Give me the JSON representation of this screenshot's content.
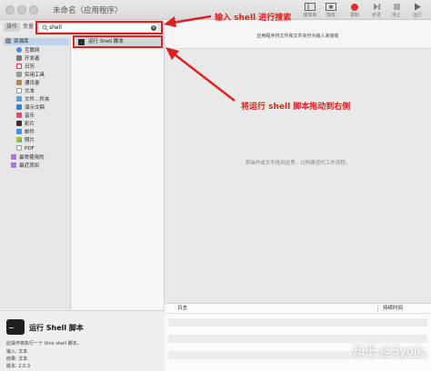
{
  "window": {
    "title": "未命名（应用程序）"
  },
  "toolbar": {
    "buttons": [
      {
        "label": "媒体库",
        "icon": "library-icon"
      },
      {
        "label": "媒体",
        "icon": "media-icon"
      },
      {
        "label": "录制",
        "icon": "record-icon"
      },
      {
        "label": "步进",
        "icon": "step-icon"
      },
      {
        "label": "停止",
        "icon": "stop-icon"
      },
      {
        "label": "运行",
        "icon": "run-icon"
      }
    ]
  },
  "search": {
    "segments": [
      "操作",
      "变量"
    ],
    "value": "shell"
  },
  "library": {
    "root": "资源库",
    "items": [
      "互联网",
      "开发者",
      "日历",
      "实用工具",
      "通讯录",
      "文本",
      "文件…件夹",
      "演示文稿",
      "音乐",
      "影片",
      "邮件",
      "照片",
      "PDF"
    ],
    "groups": [
      "最常使用的",
      "最近添加"
    ]
  },
  "actions": {
    "items": [
      "运行 Shell 脚本"
    ]
  },
  "description": {
    "title": "运行 Shell 脚本",
    "summary": "此操作将执行一个 Unix shell 脚本。",
    "input": "输入: 文本",
    "output": "结果: 文本",
    "version": "版本: 2.0.3"
  },
  "workflow": {
    "header": "应用程序将文件和文件夹作为输入来接收",
    "hint": "将操作或文件拖到这里，以构建您的工作流程。"
  },
  "log": {
    "col_log": "日志",
    "col_duration": "持续时间"
  },
  "annotations": {
    "search_note": "输入 shell 进行搜索",
    "drag_note": "将运行 shell 脚本拖动到右侧",
    "color": "#e02020"
  },
  "watermark": "知乎 @3yolk"
}
